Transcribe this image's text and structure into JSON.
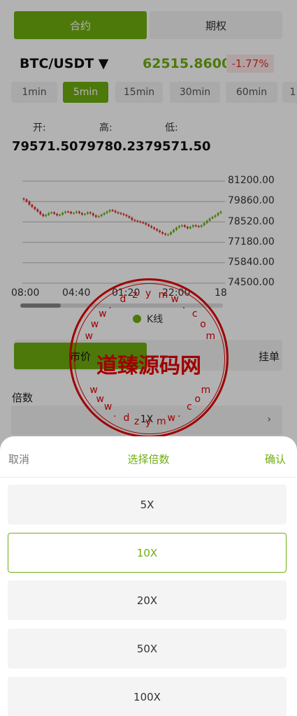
{
  "tabs": {
    "contract": "合约",
    "options": "期权"
  },
  "market": {
    "pair": "BTC/USDT ▼",
    "price": "62515.86000",
    "change": "-1.77%"
  },
  "timeframes": [
    "1min",
    "5min",
    "15min",
    "30min",
    "60min",
    "1"
  ],
  "ohl": {
    "open_label": "开:",
    "high_label": "高:",
    "low_label": "低:",
    "open": "79571.50",
    "high": "79780.23",
    "low": "79571.50"
  },
  "chart": {
    "y_ticks": [
      "81200.00",
      "79860.00",
      "78520.00",
      "77180.00",
      "75840.00",
      "74500.00"
    ],
    "x_ticks": [
      "08:00",
      "04:40",
      "01:20",
      "22:00",
      "18"
    ],
    "legend": "K线"
  },
  "chart_data": {
    "type": "candlestick",
    "series_name": "K线",
    "ylim": [
      74500,
      81200
    ],
    "x_ticks": [
      "08:00",
      "04:40",
      "01:20",
      "22:00",
      "18"
    ],
    "close_values": [
      80000,
      79860,
      79650,
      79500,
      79350,
      79200,
      79020,
      78900,
      78980,
      79100,
      79150,
      79050,
      78950,
      79000,
      79120,
      79200,
      79180,
      79080,
      79120,
      79200,
      79100,
      79000,
      79050,
      79150,
      79080,
      78950,
      78850,
      78900,
      79000,
      79100,
      79200,
      79300,
      79250,
      79150,
      79100,
      79050,
      78980,
      78900,
      78800,
      78650,
      78600,
      78550,
      78500,
      78450,
      78350,
      78250,
      78150,
      78050,
      77950,
      77850,
      77750,
      77680,
      77700,
      77850,
      78000,
      78150,
      78250,
      78300,
      78200,
      78100,
      78200,
      78300,
      78250,
      78200,
      78300,
      78450,
      78600,
      78750,
      78850,
      78950,
      79100,
      79200
    ]
  },
  "order_types": {
    "market": "市价",
    "limit": "挂单"
  },
  "leverage": {
    "label": "倍数",
    "value": "1X"
  },
  "watermark": {
    "ring": "www.dzymw.com",
    "text": "道臻源码网"
  },
  "sheet": {
    "cancel": "取消",
    "title": "选择倍数",
    "confirm": "确认",
    "options": [
      "5X",
      "10X",
      "20X",
      "50X",
      "100X"
    ],
    "selected": "10X"
  },
  "colors": {
    "accent": "#6fae10",
    "down": "#e03030",
    "watermark": "#e60000"
  }
}
